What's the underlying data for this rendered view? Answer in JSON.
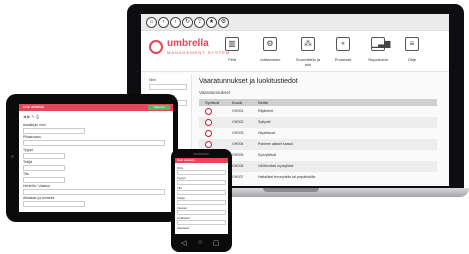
{
  "laptop": {
    "brand": {
      "name": "umbrella",
      "tagline": "MANAGEMENT SYSTEM"
    },
    "nav": [
      {
        "label": "Pelit",
        "icon": "books-icon"
      },
      {
        "label": "Johtaminen",
        "icon": "org-icon"
      },
      {
        "label": "Suunnittelu ja tuki",
        "icon": "network-icon"
      },
      {
        "label": "Prosessit",
        "icon": "process-icon"
      },
      {
        "label": "Raportointi",
        "icon": "bar-chart-icon"
      },
      {
        "label": "Ohje",
        "icon": "doc-icon"
      }
    ],
    "sidebar": {
      "labels": [
        "Nimi",
        "Lomakkeen nimi",
        "Lisätietoja"
      ]
    },
    "content": {
      "title": "Vaaratunnukset ja luokitustiedot",
      "section": "Vaaratunnukset",
      "columns": [
        "Symboli",
        "Koodi",
        "Selite"
      ],
      "rows": [
        {
          "code": "GHS01",
          "name": "Räjähteet",
          "tone": "red"
        },
        {
          "code": "GHS02",
          "name": "Syttyvät",
          "tone": "red"
        },
        {
          "code": "GHS03",
          "name": "Hapettavat",
          "tone": "red"
        },
        {
          "code": "GHS04",
          "name": "Paineen alaiset kaasut",
          "tone": "red"
        },
        {
          "code": "GHS05",
          "name": "Syövyttävät",
          "tone": "red"
        },
        {
          "code": "GHS06",
          "name": "Välittömästi myrkylliset",
          "tone": "red"
        },
        {
          "code": "GHS07",
          "name": "Haitalliset terveydelle tai ympäristölle",
          "tone": "amber"
        }
      ]
    }
  },
  "tablet": {
    "header": "Uusi asiakirja",
    "save_button": "Tallenna",
    "toolbar_icons": "◀ ▶ ✎ ⎙",
    "labels": [
      "Asiakirjan nimi",
      "Pikakuvaus",
      "Tyyppi",
      "Tekijä",
      "Tila",
      "Henkilöt / Vastuut",
      "Aikataulu ja toiminta",
      "Tarkenna"
    ]
  },
  "phone": {
    "header": "Uusi asiakirja",
    "labels": [
      "Nimi",
      "Tyyppi",
      "Tila",
      "Tekijä",
      "Vastuut",
      "Lisätiedot",
      "Aikataulu"
    ]
  }
}
